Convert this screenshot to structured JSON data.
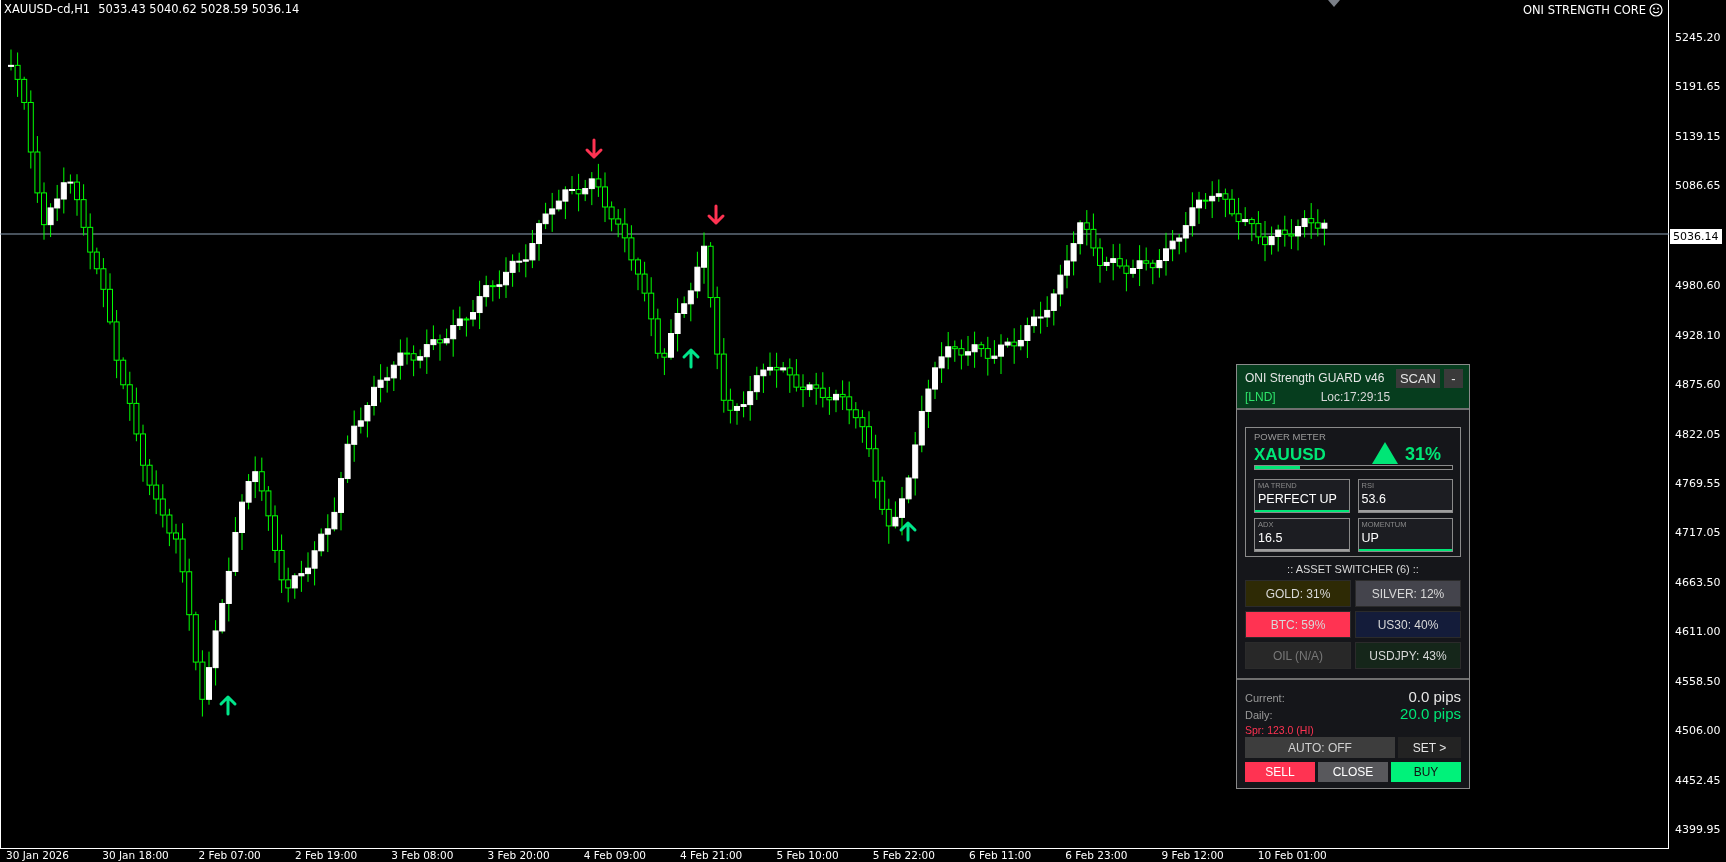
{
  "chart_header": {
    "symbol": "XAUUSD-cd,H1",
    "ohlc": "5033.43 5040.62 5028.59 5036.14"
  },
  "indicator_name": "ONI STRENGTH CORE",
  "price_axis": {
    "labels": [
      "5245.20",
      "5191.65",
      "5139.15",
      "5086.65",
      "4980.60",
      "4928.10",
      "4875.60",
      "4822.05",
      "4769.55",
      "4717.05",
      "4663.50",
      "4611.00",
      "4558.50",
      "4506.00",
      "4452.45",
      "4399.95"
    ],
    "current_price": "5036.14"
  },
  "time_axis": {
    "labels": [
      "30 Jan 2026",
      "30 Jan 18:00",
      "2 Feb 07:00",
      "2 Feb 19:00",
      "3 Feb 08:00",
      "3 Feb 20:00",
      "4 Feb 09:00",
      "4 Feb 21:00",
      "5 Feb 10:00",
      "5 Feb 22:00",
      "6 Feb 11:00",
      "6 Feb 23:00",
      "9 Feb 12:00",
      "10 Feb 01:00"
    ]
  },
  "panel": {
    "title": "ONI Strength GUARD v46",
    "scan_button": "SCAN",
    "minimize_button": "-",
    "session": "[LND]",
    "clock": "Loc:17:29:15",
    "power_meter": {
      "label": "POWER METER",
      "symbol": "XAUUSD",
      "up": true,
      "percent": "31%",
      "level": 0.23
    },
    "indicators": [
      {
        "label": "MA TREND",
        "value": "PERFECT UP",
        "color": "#00e676"
      },
      {
        "label": "RSI",
        "value": "53.6",
        "color": "#9e9e9e"
      },
      {
        "label": "ADX",
        "value": "16.5",
        "color": "#9e9e9e"
      },
      {
        "label": "MOMENTUM",
        "value": "UP",
        "color": "#00e676"
      }
    ],
    "switcher_title": ":: ASSET SWITCHER (6) ::",
    "assets": [
      {
        "label": "GOLD: 31%",
        "color": "#2e2a05",
        "disabled": false
      },
      {
        "label": "SILVER: 12%",
        "color": "#44444c",
        "disabled": false
      },
      {
        "label": "BTC: 59%",
        "color": "#ff3352",
        "disabled": false
      },
      {
        "label": "US30: 40%",
        "color": "#141c3a",
        "disabled": false
      },
      {
        "label": "OIL (N/A)",
        "color": "#282828",
        "disabled": true
      },
      {
        "label": "USDJPY: 43%",
        "color": "#15261a",
        "disabled": false
      }
    ],
    "stats": [
      {
        "label": "Current:",
        "value": "0.0 pips",
        "positive": false
      },
      {
        "label": "Daily:",
        "value": "20.0 pips",
        "positive": true
      }
    ],
    "spread_warning": "Spr: 123.0 (HI)",
    "auto_button": "AUTO: OFF",
    "set_button": "SET >",
    "trade_buttons": [
      {
        "kind": "sell",
        "label": "SELL"
      },
      {
        "kind": "close",
        "label": "CLOSE"
      },
      {
        "kind": "buy",
        "label": "BUY"
      }
    ]
  }
}
